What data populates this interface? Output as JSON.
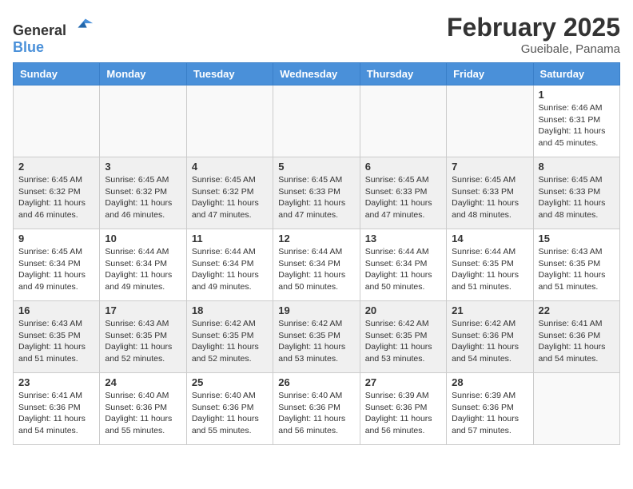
{
  "header": {
    "logo_general": "General",
    "logo_blue": "Blue",
    "month_title": "February 2025",
    "location": "Gueibale, Panama"
  },
  "days_of_week": [
    "Sunday",
    "Monday",
    "Tuesday",
    "Wednesday",
    "Thursday",
    "Friday",
    "Saturday"
  ],
  "weeks": [
    [
      {
        "day": "",
        "info": ""
      },
      {
        "day": "",
        "info": ""
      },
      {
        "day": "",
        "info": ""
      },
      {
        "day": "",
        "info": ""
      },
      {
        "day": "",
        "info": ""
      },
      {
        "day": "",
        "info": ""
      },
      {
        "day": "1",
        "info": "Sunrise: 6:46 AM\nSunset: 6:31 PM\nDaylight: 11 hours\nand 45 minutes."
      }
    ],
    [
      {
        "day": "2",
        "info": "Sunrise: 6:45 AM\nSunset: 6:32 PM\nDaylight: 11 hours\nand 46 minutes."
      },
      {
        "day": "3",
        "info": "Sunrise: 6:45 AM\nSunset: 6:32 PM\nDaylight: 11 hours\nand 46 minutes."
      },
      {
        "day": "4",
        "info": "Sunrise: 6:45 AM\nSunset: 6:32 PM\nDaylight: 11 hours\nand 47 minutes."
      },
      {
        "day": "5",
        "info": "Sunrise: 6:45 AM\nSunset: 6:33 PM\nDaylight: 11 hours\nand 47 minutes."
      },
      {
        "day": "6",
        "info": "Sunrise: 6:45 AM\nSunset: 6:33 PM\nDaylight: 11 hours\nand 47 minutes."
      },
      {
        "day": "7",
        "info": "Sunrise: 6:45 AM\nSunset: 6:33 PM\nDaylight: 11 hours\nand 48 minutes."
      },
      {
        "day": "8",
        "info": "Sunrise: 6:45 AM\nSunset: 6:33 PM\nDaylight: 11 hours\nand 48 minutes."
      }
    ],
    [
      {
        "day": "9",
        "info": "Sunrise: 6:45 AM\nSunset: 6:34 PM\nDaylight: 11 hours\nand 49 minutes."
      },
      {
        "day": "10",
        "info": "Sunrise: 6:44 AM\nSunset: 6:34 PM\nDaylight: 11 hours\nand 49 minutes."
      },
      {
        "day": "11",
        "info": "Sunrise: 6:44 AM\nSunset: 6:34 PM\nDaylight: 11 hours\nand 49 minutes."
      },
      {
        "day": "12",
        "info": "Sunrise: 6:44 AM\nSunset: 6:34 PM\nDaylight: 11 hours\nand 50 minutes."
      },
      {
        "day": "13",
        "info": "Sunrise: 6:44 AM\nSunset: 6:34 PM\nDaylight: 11 hours\nand 50 minutes."
      },
      {
        "day": "14",
        "info": "Sunrise: 6:44 AM\nSunset: 6:35 PM\nDaylight: 11 hours\nand 51 minutes."
      },
      {
        "day": "15",
        "info": "Sunrise: 6:43 AM\nSunset: 6:35 PM\nDaylight: 11 hours\nand 51 minutes."
      }
    ],
    [
      {
        "day": "16",
        "info": "Sunrise: 6:43 AM\nSunset: 6:35 PM\nDaylight: 11 hours\nand 51 minutes."
      },
      {
        "day": "17",
        "info": "Sunrise: 6:43 AM\nSunset: 6:35 PM\nDaylight: 11 hours\nand 52 minutes."
      },
      {
        "day": "18",
        "info": "Sunrise: 6:42 AM\nSunset: 6:35 PM\nDaylight: 11 hours\nand 52 minutes."
      },
      {
        "day": "19",
        "info": "Sunrise: 6:42 AM\nSunset: 6:35 PM\nDaylight: 11 hours\nand 53 minutes."
      },
      {
        "day": "20",
        "info": "Sunrise: 6:42 AM\nSunset: 6:35 PM\nDaylight: 11 hours\nand 53 minutes."
      },
      {
        "day": "21",
        "info": "Sunrise: 6:42 AM\nSunset: 6:36 PM\nDaylight: 11 hours\nand 54 minutes."
      },
      {
        "day": "22",
        "info": "Sunrise: 6:41 AM\nSunset: 6:36 PM\nDaylight: 11 hours\nand 54 minutes."
      }
    ],
    [
      {
        "day": "23",
        "info": "Sunrise: 6:41 AM\nSunset: 6:36 PM\nDaylight: 11 hours\nand 54 minutes."
      },
      {
        "day": "24",
        "info": "Sunrise: 6:40 AM\nSunset: 6:36 PM\nDaylight: 11 hours\nand 55 minutes."
      },
      {
        "day": "25",
        "info": "Sunrise: 6:40 AM\nSunset: 6:36 PM\nDaylight: 11 hours\nand 55 minutes."
      },
      {
        "day": "26",
        "info": "Sunrise: 6:40 AM\nSunset: 6:36 PM\nDaylight: 11 hours\nand 56 minutes."
      },
      {
        "day": "27",
        "info": "Sunrise: 6:39 AM\nSunset: 6:36 PM\nDaylight: 11 hours\nand 56 minutes."
      },
      {
        "day": "28",
        "info": "Sunrise: 6:39 AM\nSunset: 6:36 PM\nDaylight: 11 hours\nand 57 minutes."
      },
      {
        "day": "",
        "info": ""
      }
    ]
  ]
}
